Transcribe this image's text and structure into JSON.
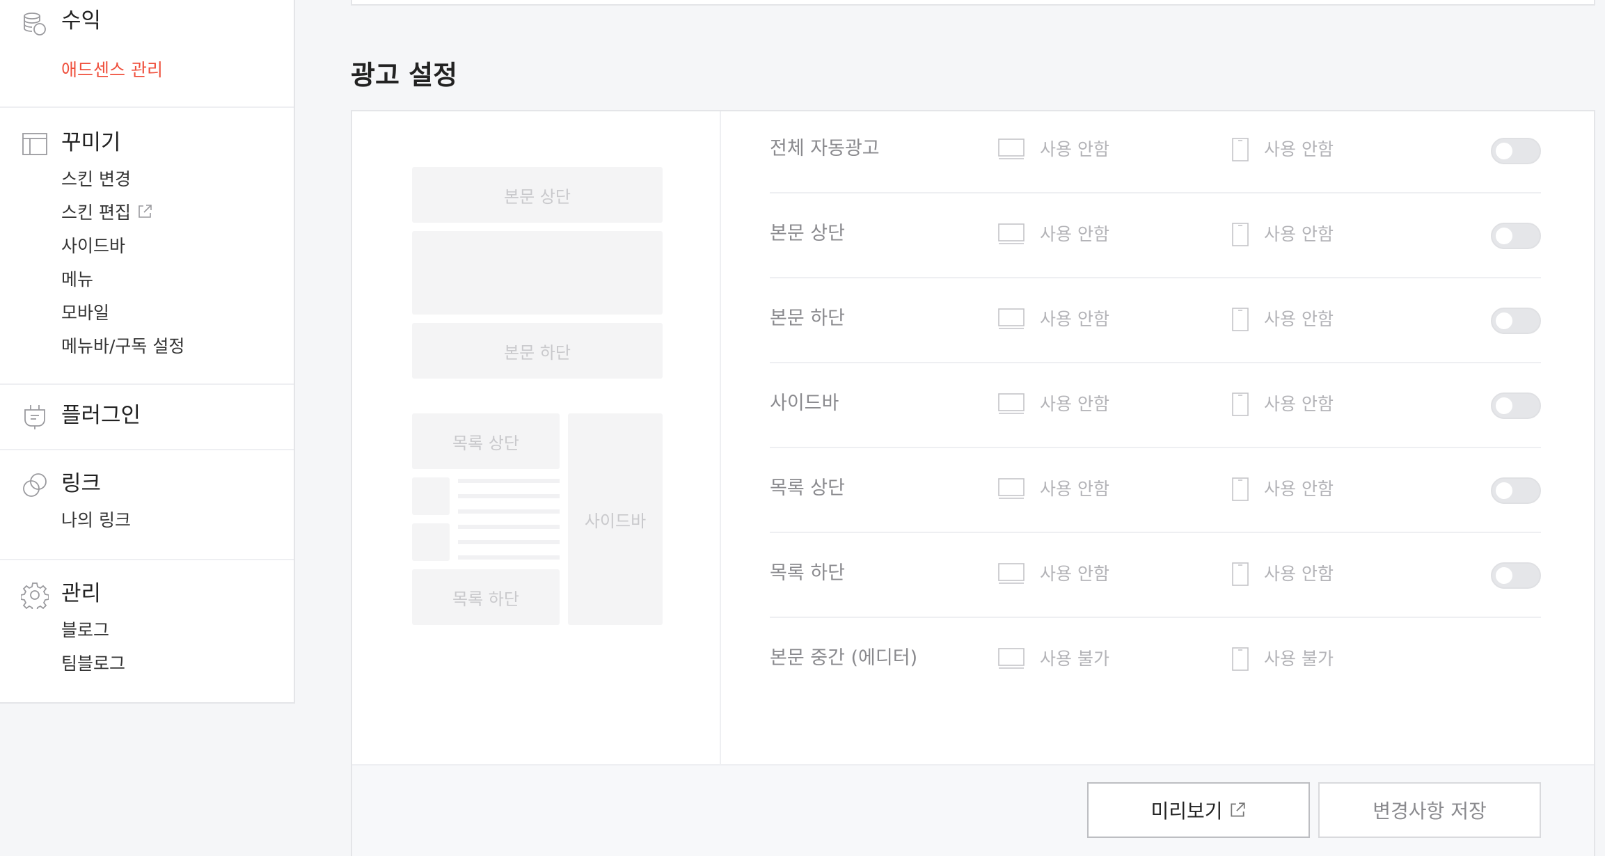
{
  "sidebar": {
    "revenue": {
      "title": "수익",
      "icon": "coins-icon",
      "items": [
        {
          "label": "애드센스 관리",
          "active": true
        }
      ]
    },
    "design": {
      "title": "꾸미기",
      "icon": "layout-icon",
      "items": [
        {
          "label": "스킨 변경"
        },
        {
          "label": "스킨 편집",
          "external": true
        },
        {
          "label": "사이드바"
        },
        {
          "label": "메뉴"
        },
        {
          "label": "모바일"
        },
        {
          "label": "메뉴바/구독 설정"
        }
      ]
    },
    "plugin": {
      "title": "플러그인",
      "icon": "plug-icon"
    },
    "link": {
      "title": "링크",
      "icon": "link-icon",
      "items": [
        {
          "label": "나의 링크"
        }
      ]
    },
    "manage": {
      "title": "관리",
      "icon": "gear-icon",
      "items": [
        {
          "label": "블로그"
        },
        {
          "label": "팀블로그"
        }
      ]
    }
  },
  "page": {
    "title": "광고 설정"
  },
  "preview": {
    "body_top": "본문 상단",
    "body_bottom": "본문 하단",
    "list_top": "목록 상단",
    "list_bottom": "목록 하단",
    "sidebar": "사이드바"
  },
  "ads": {
    "rows": [
      {
        "label": "전체 자동광고",
        "pc": "사용 안함",
        "mobile": "사용 안함",
        "toggle": false
      },
      {
        "label": "본문 상단",
        "pc": "사용 안함",
        "mobile": "사용 안함",
        "toggle": false
      },
      {
        "label": "본문 하단",
        "pc": "사용 안함",
        "mobile": "사용 안함",
        "toggle": false
      },
      {
        "label": "사이드바",
        "pc": "사용 안함",
        "mobile": "사용 안함",
        "toggle": false
      },
      {
        "label": "목록 상단",
        "pc": "사용 안함",
        "mobile": "사용 안함",
        "toggle": false
      },
      {
        "label": "목록 하단",
        "pc": "사용 안함",
        "mobile": "사용 안함",
        "toggle": false
      },
      {
        "label": "본문 중간 (에디터)",
        "pc": "사용 불가",
        "mobile": "사용 불가",
        "toggle": null
      }
    ]
  },
  "actions": {
    "preview": "미리보기",
    "save": "변경사항 저장"
  },
  "colors": {
    "accent": "#ef4f3c",
    "background": "#f5f6f8"
  }
}
